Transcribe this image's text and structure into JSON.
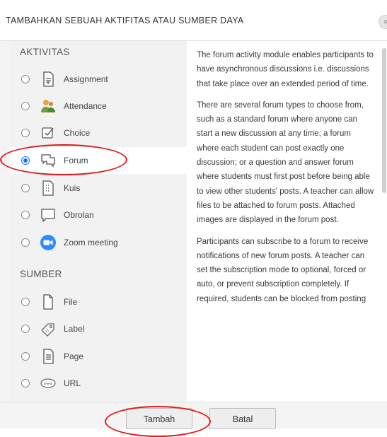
{
  "dialog": {
    "title": "TAMBAHKAN SEBUAH AKTIFITAS ATAU SUMBER DAYA",
    "close_label": "×"
  },
  "sections": {
    "activities_title": "AKTIVITAS",
    "resources_title": "SUMBER"
  },
  "activities": [
    {
      "label": "Assignment",
      "icon": "assignment-icon",
      "selected": false
    },
    {
      "label": "Attendance",
      "icon": "attendance-icon",
      "selected": false
    },
    {
      "label": "Choice",
      "icon": "choice-icon",
      "selected": false
    },
    {
      "label": "Forum",
      "icon": "forum-icon",
      "selected": true
    },
    {
      "label": "Kuis",
      "icon": "quiz-icon",
      "selected": false
    },
    {
      "label": "Obrolan",
      "icon": "chat-icon",
      "selected": false
    },
    {
      "label": "Zoom meeting",
      "icon": "zoom-icon",
      "selected": false
    }
  ],
  "resources": [
    {
      "label": "File",
      "icon": "file-icon",
      "selected": false
    },
    {
      "label": "Label",
      "icon": "label-icon",
      "selected": false
    },
    {
      "label": "Page",
      "icon": "page-icon",
      "selected": false
    },
    {
      "label": "URL",
      "icon": "url-icon",
      "selected": false
    }
  ],
  "description": {
    "paragraphs": [
      "The forum activity module enables participants to have asynchronous discussions i.e. discussions that take place over an extended period of time.",
      "There are several forum types to choose from, such as a standard forum where anyone can start a new discussion at any time; a forum where each student can post exactly one discussion; or a question and answer forum where students must first post before being able to view other students' posts. A teacher can allow files to be attached to forum posts. Attached images are displayed in the forum post.",
      "Participants can subscribe to a forum to receive notifications of new forum posts. A teacher can set the subscription mode to optional, forced or auto, or prevent subscription completely. If required, students can be blocked from posting"
    ]
  },
  "footer": {
    "add_label": "Tambah",
    "cancel_label": "Batal"
  },
  "colors": {
    "accent": "#1a73e8",
    "highlight": "#e11919",
    "zoom": "#2d8cff"
  }
}
